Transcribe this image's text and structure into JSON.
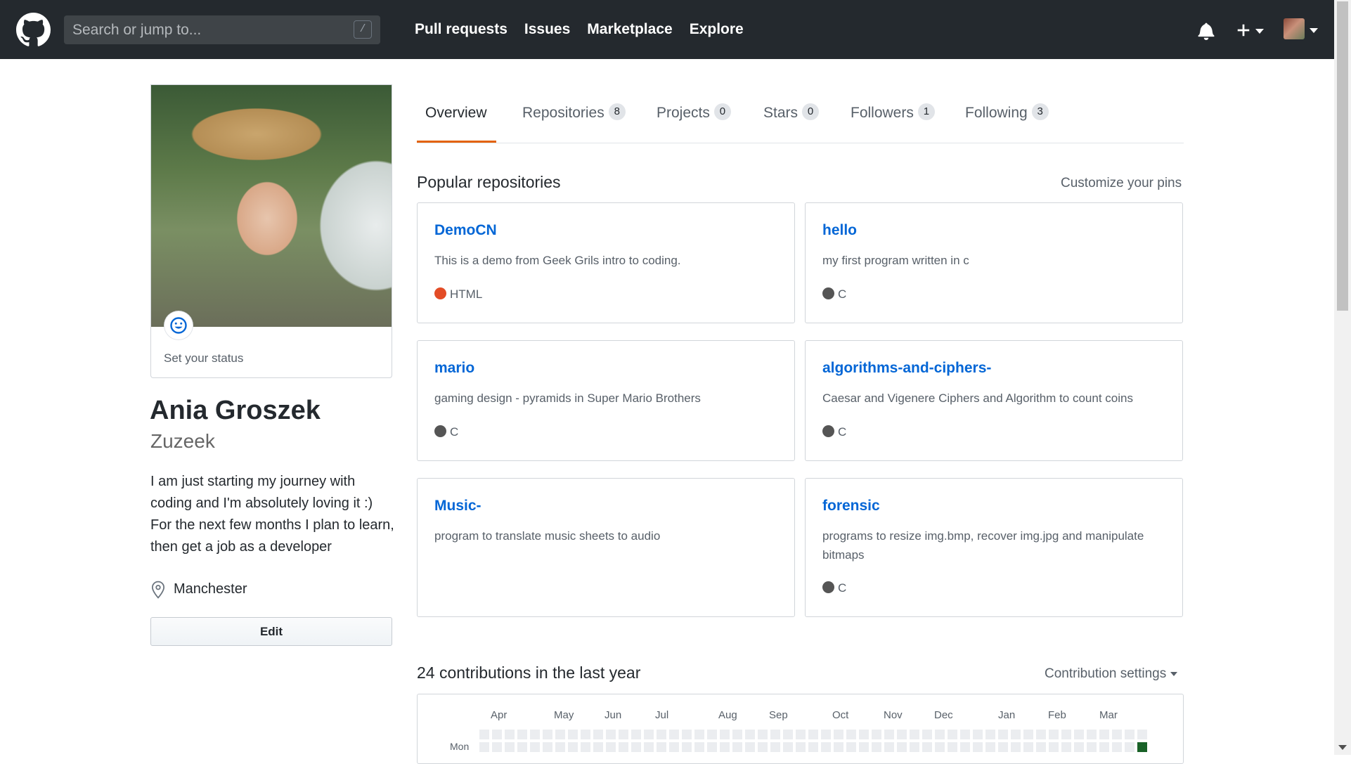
{
  "header": {
    "search_placeholder": "Search or jump to...",
    "search_shortcut": "/",
    "nav": [
      "Pull requests",
      "Issues",
      "Marketplace",
      "Explore"
    ]
  },
  "profile": {
    "status_text": "Set your status",
    "full_name": "Ania Groszek",
    "username": "Zuzeek",
    "bio": "I am just starting my journey with coding and I'm absolutely loving it :) For the next few months I plan to learn, then get a job as a developer",
    "location": "Manchester",
    "edit_label": "Edit"
  },
  "tabs": [
    {
      "label": "Overview",
      "count": null,
      "selected": true
    },
    {
      "label": "Repositories",
      "count": "8",
      "selected": false
    },
    {
      "label": "Projects",
      "count": "0",
      "selected": false
    },
    {
      "label": "Stars",
      "count": "0",
      "selected": false
    },
    {
      "label": "Followers",
      "count": "1",
      "selected": false
    },
    {
      "label": "Following",
      "count": "3",
      "selected": false
    }
  ],
  "popular": {
    "title": "Popular repositories",
    "customize_label": "Customize your pins",
    "repos": [
      {
        "name": "DemoCN",
        "description": "This is a demo from Geek Grils intro to coding.",
        "language": "HTML",
        "language_color": "#e34c26"
      },
      {
        "name": "hello",
        "description": "my first program written in c",
        "language": "C",
        "language_color": "#555555"
      },
      {
        "name": "mario",
        "description": "gaming design - pyramids in Super Mario Brothers",
        "language": "C",
        "language_color": "#555555"
      },
      {
        "name": "algorithms-and-ciphers-",
        "description": "Caesar and Vigenere Ciphers and Algorithm to count coins",
        "language": "C",
        "language_color": "#555555"
      },
      {
        "name": "Music-",
        "description": "program to translate music sheets to audio",
        "language": "",
        "language_color": ""
      },
      {
        "name": "forensic",
        "description": "programs to resize img.bmp, recover img.jpg and manipulate bitmaps",
        "language": "C",
        "language_color": "#555555"
      }
    ]
  },
  "contributions": {
    "title": "24 contributions in the last year",
    "settings_label": "Contribution settings",
    "months": [
      "Apr",
      "May",
      "Jun",
      "Jul",
      "Aug",
      "Sep",
      "Oct",
      "Nov",
      "Dec",
      "Jan",
      "Feb",
      "Mar"
    ],
    "day_label": "Mon",
    "empty_color": "#ebedf0",
    "active_color": "#196127"
  },
  "colors": {
    "header_bg": "#24292e",
    "link": "#0366d6",
    "tab_accent": "#e36209"
  },
  "icons": {
    "logo": "github-octocat-icon",
    "bell": "bell-icon",
    "plus": "plus-icon",
    "status": "smiley-icon",
    "location": "location-pin-icon"
  }
}
